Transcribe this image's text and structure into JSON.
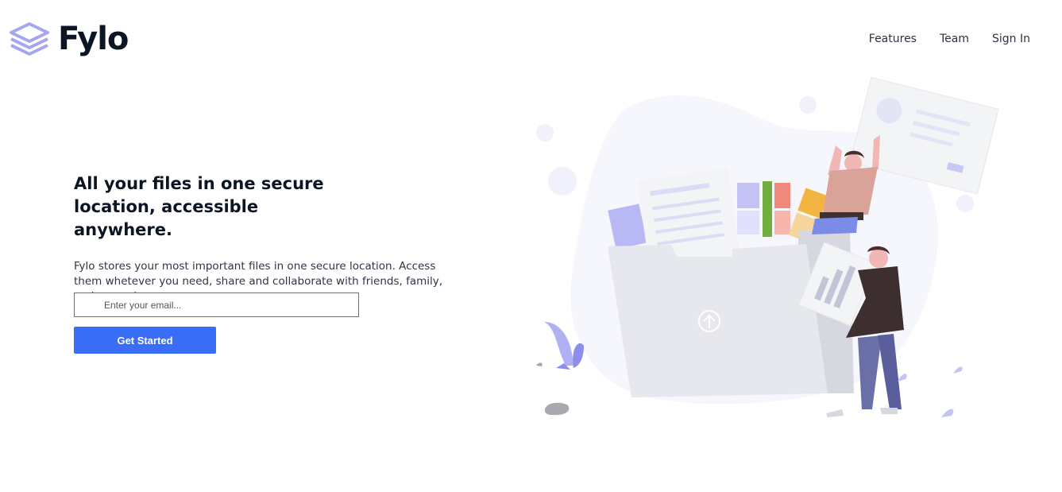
{
  "brand": {
    "name": "Fylo",
    "logo_icon": "layers-icon",
    "accent": "#3a6df5"
  },
  "nav": {
    "items": [
      {
        "label": "Features"
      },
      {
        "label": "Team"
      },
      {
        "label": "Sign In"
      }
    ]
  },
  "hero": {
    "headline": "All your files in one secure location, accessible anywhere.",
    "body": "Fylo stores your most important files in one secure location. Access them whetever you need, share and collaborate with friends, family, and co-workers.",
    "email_placeholder": "Enter your email...",
    "email_value": "",
    "cta_label": "Get Started"
  },
  "illustration": {
    "icon": "upload-arrow-icon"
  }
}
